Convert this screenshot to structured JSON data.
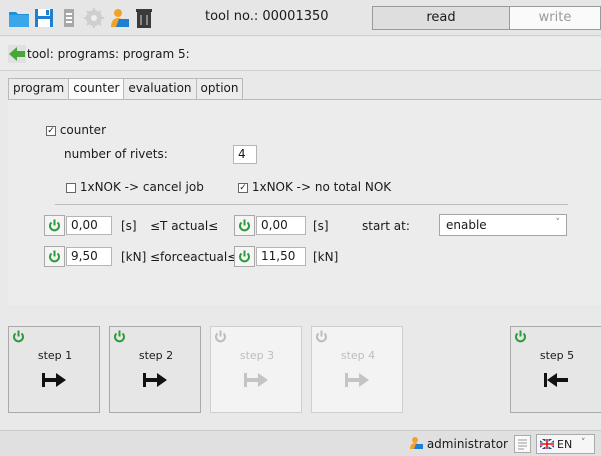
{
  "toolbar": {
    "tool_no": "tool no.: 00001350",
    "read_label": "read",
    "write_label": "write",
    "icons": [
      "folder-icon",
      "save-icon",
      "print-icon",
      "gear-icon",
      "user-icon",
      "trash-icon"
    ]
  },
  "breadcrumb": "tool: programs: program 5:",
  "tabs": [
    "program",
    "counter",
    "evaluation",
    "option"
  ],
  "active_tab": "counter",
  "counter": {
    "counter_label": "counter",
    "counter_checked": true,
    "rivets_label": "number of rivets:",
    "rivets_value": "4",
    "nok_cancel_label": "1xNOK -> cancel job",
    "nok_cancel_checked": false,
    "nok_total_label": "1xNOK -> no total NOK",
    "nok_total_checked": true
  },
  "limits": {
    "time_min": "0,00",
    "time_unit": "[s]",
    "time_relation": "≤T actual≤",
    "time_max": "0,00",
    "time_unit_max": "[s]",
    "force_min": "9,50",
    "force_unit": "[kN]",
    "force_relation": "≤forceactual≤",
    "force_max": "11,50",
    "force_unit_max": "[kN]",
    "start_at_label": "start at:",
    "start_at_value": "enable"
  },
  "steps": [
    {
      "label": "step 1",
      "enabled": true,
      "arrow": "arrow-right-bar-icon"
    },
    {
      "label": "step 2",
      "enabled": true,
      "arrow": "arrow-right-bar-icon"
    },
    {
      "label": "step 3",
      "enabled": false,
      "arrow": "arrow-right-bar-icon"
    },
    {
      "label": "step 4",
      "enabled": false,
      "arrow": "arrow-right-bar-icon"
    },
    {
      "label": "step 5",
      "enabled": true,
      "arrow": "arrow-left-bar-icon"
    }
  ],
  "status": {
    "user": "administrator",
    "language": "EN"
  },
  "colors": {
    "power_green": "#2e9b3a",
    "disabled_gray": "#b9b9b9",
    "back_arrow": "#4aa63a"
  }
}
